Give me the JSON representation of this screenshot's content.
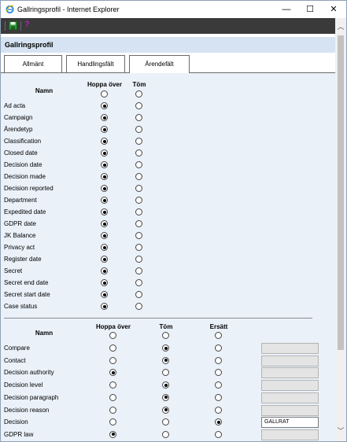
{
  "window": {
    "title": "Gallringsprofil - Internet Explorer",
    "minimize_symbol": "—",
    "maximize_symbol": "☐",
    "close_symbol": "✕"
  },
  "toolbar": {
    "help_symbol": "?"
  },
  "header": {
    "title": "Gallringsprofil"
  },
  "tabs": [
    {
      "label": "Allmänt",
      "active": false
    },
    {
      "label": "Handlingsfält",
      "active": false
    },
    {
      "label": "Ärendefält",
      "active": true
    }
  ],
  "section1": {
    "col_name": "Namn",
    "col_skip": "Hoppa över",
    "col_empty": "Töm",
    "rows": [
      {
        "label": "Ad acta",
        "selected": "skip"
      },
      {
        "label": "Campaign",
        "selected": "skip"
      },
      {
        "label": "Ärendetyp",
        "selected": "skip"
      },
      {
        "label": "Classification",
        "selected": "skip"
      },
      {
        "label": "Closed date",
        "selected": "skip"
      },
      {
        "label": "Decision date",
        "selected": "skip"
      },
      {
        "label": "Decision made",
        "selected": "skip"
      },
      {
        "label": "Decision reported",
        "selected": "skip"
      },
      {
        "label": "Department",
        "selected": "skip"
      },
      {
        "label": "Expedited date",
        "selected": "skip"
      },
      {
        "label": "GDPR date",
        "selected": "skip"
      },
      {
        "label": "JK Balance",
        "selected": "skip"
      },
      {
        "label": "Privacy act",
        "selected": "skip"
      },
      {
        "label": "Register date",
        "selected": "skip"
      },
      {
        "label": "Secret",
        "selected": "skip"
      },
      {
        "label": "Secret end date",
        "selected": "skip"
      },
      {
        "label": "Secret start date",
        "selected": "skip"
      },
      {
        "label": "Case status",
        "selected": "skip"
      }
    ]
  },
  "section2": {
    "col_name": "Namn",
    "col_skip": "Hoppa över",
    "col_empty": "Töm",
    "col_replace": "Ersätt",
    "rows": [
      {
        "label": "Compare",
        "selected": "empty",
        "value": ""
      },
      {
        "label": "Contact",
        "selected": "empty",
        "value": ""
      },
      {
        "label": "Decision authority",
        "selected": "skip",
        "value": ""
      },
      {
        "label": "Decision level",
        "selected": "empty",
        "value": ""
      },
      {
        "label": "Decision paragraph",
        "selected": "empty",
        "value": ""
      },
      {
        "label": "Decision reason",
        "selected": "empty",
        "value": ""
      },
      {
        "label": "Decision",
        "selected": "replace",
        "value": "GALLRAT"
      },
      {
        "label": "GDPR law",
        "selected": "skip",
        "value": ""
      }
    ]
  },
  "colors": {
    "toolbar_bg": "#3a3a3a",
    "header_bg": "#d6e3f2",
    "content_bg": "#eaf1f9",
    "ie_icon": "#1e88d8",
    "save_icon": "#2e9a3a",
    "help_icon": "#a02aa8"
  },
  "icons": [
    "ie-icon",
    "save-icon",
    "help-icon",
    "scroll-up-icon",
    "scroll-down-icon"
  ]
}
